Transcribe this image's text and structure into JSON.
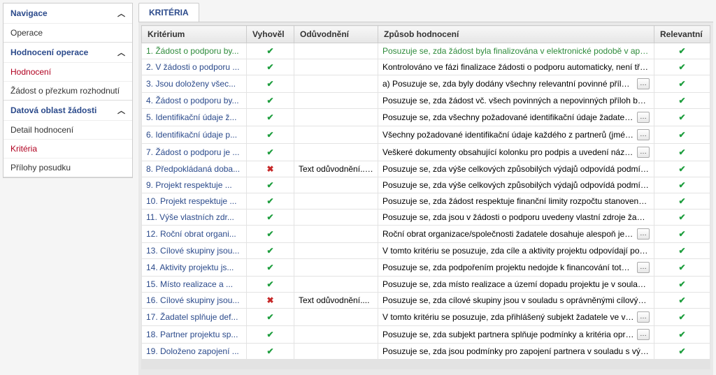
{
  "sidebar": {
    "nav": {
      "header": "Navigace",
      "items": [
        "Operace"
      ]
    },
    "hod": {
      "header": "Hodnocení operace",
      "items": [
        "Hodnocení",
        "Žádost o přezkum rozhodnutí"
      ],
      "active_index": 0
    },
    "dat": {
      "header": "Datová oblast žádosti",
      "items": [
        "Detail hodnocení",
        "Kritéria",
        "Přílohy posudku"
      ],
      "active_index": 1
    }
  },
  "tab_label": "KRITÉRIA",
  "columns": {
    "kriterium": "Kritérium",
    "vyhovel": "Vyhověl",
    "oduvodneni": "Odůvodnění",
    "zpusob": "Způsob hodnocení",
    "relevantni": "Relevantní"
  },
  "more_label": "…",
  "rows": [
    {
      "k": "1. Žádost o podporu by...",
      "pass": true,
      "od": "",
      "z": "Posuzuje se, zda žádost byla finalizována v elektronické podobě v aplikaci systému MS2014+.",
      "rel": true,
      "sel": true,
      "more": false
    },
    {
      "k": "2. V žádosti o podporu ...",
      "pass": true,
      "od": "",
      "z": "Kontrolováno ve fázi finalizace žádosti o podporu automaticky, není třeba kontrola hodnotitelem.",
      "rel": true,
      "more": false
    },
    {
      "k": "3. Jsou doloženy všec...",
      "pass": true,
      "od": "",
      "z": "a) Posuzuje se, zda byly dodány všechny relevantní povinné přílohy, které byly specifikovány ve vý",
      "rel": true,
      "more": true
    },
    {
      "k": "4. Žádost o podporu by...",
      "pass": true,
      "od": "",
      "z": "Posuzuje se, zda žádost vč. všech povinných a nepovinných příloh byla předložena v jazyce stano...",
      "rel": true,
      "more": false
    },
    {
      "k": "5. Identifikační údaje ž...",
      "pass": true,
      "od": "",
      "z": "Posuzuje se, zda všechny požadované identifikační údaje žadatele (jméno statutárního orgánu nel",
      "rel": true,
      "more": true
    },
    {
      "k": "6. Identifikační údaje p...",
      "pass": true,
      "od": "",
      "z": "Všechny požadované identifikační údaje každého z partnerů (jméno statutárního orgánu/orgánů n",
      "rel": true,
      "more": true
    },
    {
      "k": "7. Žádost o podporu je ...",
      "pass": true,
      "od": "",
      "z": "Veškeré dokumenty obsahující kolonku pro podpis a uvedení názvu/identifikačních znaků subjektu",
      "rel": true,
      "more": true
    },
    {
      "k": "8. Předpokládaná doba...",
      "pass": false,
      "od": "Text odůvodnění......",
      "z": "Posuzuje se, zda výše celkových způsobilých výdajů odpovídá podmínkám výzvy. Posuzuje se, zd...",
      "rel": true,
      "more": false
    },
    {
      "k": "9. Projekt respektuje ...",
      "pass": true,
      "od": "",
      "z": "Posuzuje se, zda výše celkových způsobilých výdajů odpovídá podmínkám výzvy. Posuzuje se, zd...",
      "rel": true,
      "more": false
    },
    {
      "k": "10. Projekt respektuje ...",
      "pass": true,
      "od": "",
      "z": "Posuzuje se, zda žádost respektuje finanční limity rozpočtu stanovené výzvou a Pravidly pro žada...",
      "rel": true,
      "more": false
    },
    {
      "k": "11. Výše vlastních zdr...",
      "pass": true,
      "od": "",
      "z": "Posuzuje se, zda jsou v žádosti o podporu uvedeny vlastní zdroje žadatele (je-li v rámci výzvy rele...",
      "rel": true,
      "more": false
    },
    {
      "k": "12. Roční obrat organi...",
      "pass": true,
      "od": "",
      "z": "Roční obrat organizace/společnosti žadatele dosahuje alespoň jedné poloviny hodnoty částky způ",
      "rel": true,
      "more": true
    },
    {
      "k": "13. Cílové skupiny jsou...",
      "pass": true,
      "od": "",
      "z": "V tomto kritériu se posuzuje, zda cíle a aktivity projektu odpovídají podmínkám v dané výzvě. Pos...",
      "rel": true,
      "more": false
    },
    {
      "k": "14. Aktivity projektu js...",
      "pass": true,
      "od": "",
      "z": "Posuzuje se, zda podpořením projektu nedojde k financování totožných výstupů, na které již byla ž",
      "rel": true,
      "more": true
    },
    {
      "k": "15. Místo realizace a ...",
      "pass": true,
      "od": "",
      "z": "Posuzuje se, zda místo realizace a území dopadu projektu je v souladu s podmínkami stanoveným...",
      "rel": true,
      "more": false
    },
    {
      "k": "16. Cílové skupiny jsou...",
      "pass": false,
      "od": "Text odůvodnění....",
      "z": "Posuzuje se, zda cílové skupiny jsou v souladu s oprávněnými cílovými skupinami ve výzvě. Posu...",
      "rel": true,
      "more": false
    },
    {
      "k": "17. Žadatel splňuje def...",
      "pass": true,
      "od": "",
      "z": "V tomto kritériu se posuzuje, zda přihlášený subjekt žadatele ve výzvě splňuje podmínky a kritéria",
      "rel": true,
      "more": true
    },
    {
      "k": "18. Partner projektu sp...",
      "pass": true,
      "od": "",
      "z": "Posuzuje se, zda subjekt partnera splňuje podmínky a kritéria oprávněnosti a partnerství stanoven",
      "rel": true,
      "more": true
    },
    {
      "k": "19. Doloženo zapojení ...",
      "pass": true,
      "od": "",
      "z": "Posuzuje se, zda jsou podmínky pro zapojení partnera v souladu s výzvou.",
      "rel": true,
      "more": false
    }
  ]
}
